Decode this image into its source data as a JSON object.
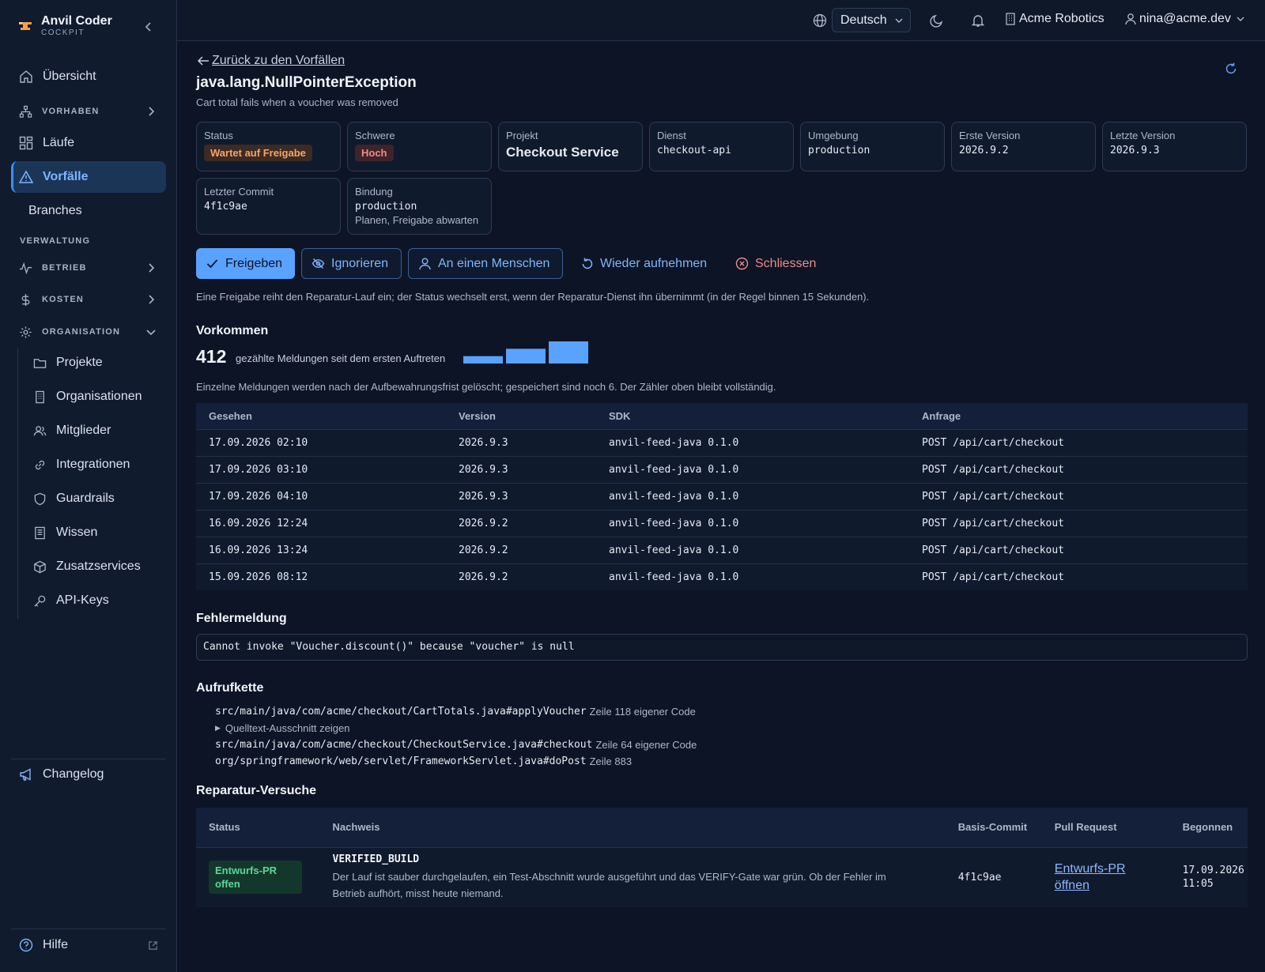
{
  "brand": {
    "name": "Anvil Coder",
    "sub": "COCKPIT"
  },
  "sidebar": {
    "overview": "Übersicht",
    "group_vorhaben": "VORHABEN",
    "laeufe": "Läufe",
    "vorfaelle": "Vorfälle",
    "branches": "Branches",
    "section_verwaltung": "VERWALTUNG",
    "group_betrieb": "BETRIEB",
    "group_kosten": "KOSTEN",
    "group_organisation": "ORGANISATION",
    "sub_items": [
      "Projekte",
      "Organisationen",
      "Mitglieder",
      "Integrationen",
      "Guardrails",
      "Wissen",
      "Zusatzservices",
      "API-Keys"
    ],
    "changelog": "Changelog",
    "help": "Hilfe"
  },
  "topbar": {
    "language": "Deutsch",
    "org": "Acme Robotics",
    "user": "nina@acme.dev"
  },
  "incident": {
    "back": "Zurück zu den Vorfällen",
    "title": "java.lang.NullPointerException",
    "subtitle": "Cart total fails when a voucher was removed",
    "cards": {
      "status_label": "Status",
      "status_value": "Wartet auf Freigabe",
      "severity_label": "Schwere",
      "severity_value": "Hoch",
      "project_label": "Projekt",
      "project_value": "Checkout Service",
      "service_label": "Dienst",
      "service_value": "checkout-api",
      "env_label": "Umgebung",
      "env_value": "production",
      "first_label": "Erste Version",
      "first_value": "2026.9.2",
      "last_label": "Letzte Version",
      "last_value": "2026.9.3",
      "commit_label": "Letzter Commit",
      "commit_value": "4f1c9ae",
      "binding_label": "Bindung",
      "binding_value": "production",
      "binding_note": "Planen, Freigabe abwarten"
    },
    "actions": {
      "approve": "Freigeben",
      "ignore": "Ignorieren",
      "human": "An einen Menschen",
      "resume": "Wieder aufnehmen",
      "close": "Schliessen"
    },
    "hint": "Eine Freigabe reiht den Reparatur-Lauf ein; der Status wechselt erst, wenn der Reparatur-Dienst ihn übernimmt (in der Regel binnen 15 Sekunden)."
  },
  "occurrences": {
    "heading": "Vorkommen",
    "count": "412",
    "count_text": "gezählte Meldungen seit dem ersten Auftreten",
    "spark_values": [
      1,
      2,
      3
    ],
    "note": "Einzelne Meldungen werden nach der Aufbewahrungsfrist gelöscht; gespeichert sind noch 6. Der Zähler oben bleibt vollständig.",
    "columns": [
      "Gesehen",
      "Version",
      "SDK",
      "Anfrage"
    ],
    "rows": [
      [
        "17.09.2026 02:10",
        "2026.9.3",
        "anvil-feed-java 0.1.0",
        "POST /api/cart/checkout"
      ],
      [
        "17.09.2026 03:10",
        "2026.9.3",
        "anvil-feed-java 0.1.0",
        "POST /api/cart/checkout"
      ],
      [
        "17.09.2026 04:10",
        "2026.9.3",
        "anvil-feed-java 0.1.0",
        "POST /api/cart/checkout"
      ],
      [
        "16.09.2026 12:24",
        "2026.9.2",
        "anvil-feed-java 0.1.0",
        "POST /api/cart/checkout"
      ],
      [
        "16.09.2026 13:24",
        "2026.9.2",
        "anvil-feed-java 0.1.0",
        "POST /api/cart/checkout"
      ],
      [
        "15.09.2026 08:12",
        "2026.9.2",
        "anvil-feed-java 0.1.0",
        "POST /api/cart/checkout"
      ]
    ]
  },
  "error": {
    "heading": "Fehlermeldung",
    "message": "Cannot invoke \"Voucher.discount()\" because \"voucher\" is null"
  },
  "stack": {
    "heading": "Aufrufkette",
    "frames": [
      {
        "path": "src/main/java/com/acme/checkout/CartTotals.java#applyVoucher",
        "meta": "Zeile 118 eigener Code"
      },
      {
        "path": "src/main/java/com/acme/checkout/CheckoutService.java#checkout",
        "meta": "Zeile 64 eigener Code"
      },
      {
        "path": "org/springframework/web/servlet/FrameworkServlet.java#doPost",
        "meta": "Zeile 883"
      }
    ],
    "toggle": "Quelltext-Ausschnitt zeigen"
  },
  "repairs": {
    "heading": "Reparatur-Versuche",
    "columns": [
      "Status",
      "Nachweis",
      "Basis-Commit",
      "Pull Request",
      "Begonnen"
    ],
    "row": {
      "status": "Entwurfs-PR offen",
      "evidence_code": "VERIFIED_BUILD",
      "evidence_text": "Der Lauf ist sauber durchgelaufen, ein Test-Abschnitt wurde ausgeführt und das VERIFY-Gate war grün. Ob der Fehler im Betrieb aufhört, misst heute niemand.",
      "commit": "4f1c9ae",
      "pr": "Entwurfs-PR öffnen",
      "started": "17.09.2026 11:05"
    }
  },
  "colors": {
    "accent": "#5aa2ff",
    "warn": "#f3a56d",
    "danger": "#f08a8a",
    "success": "#5ed59a"
  }
}
